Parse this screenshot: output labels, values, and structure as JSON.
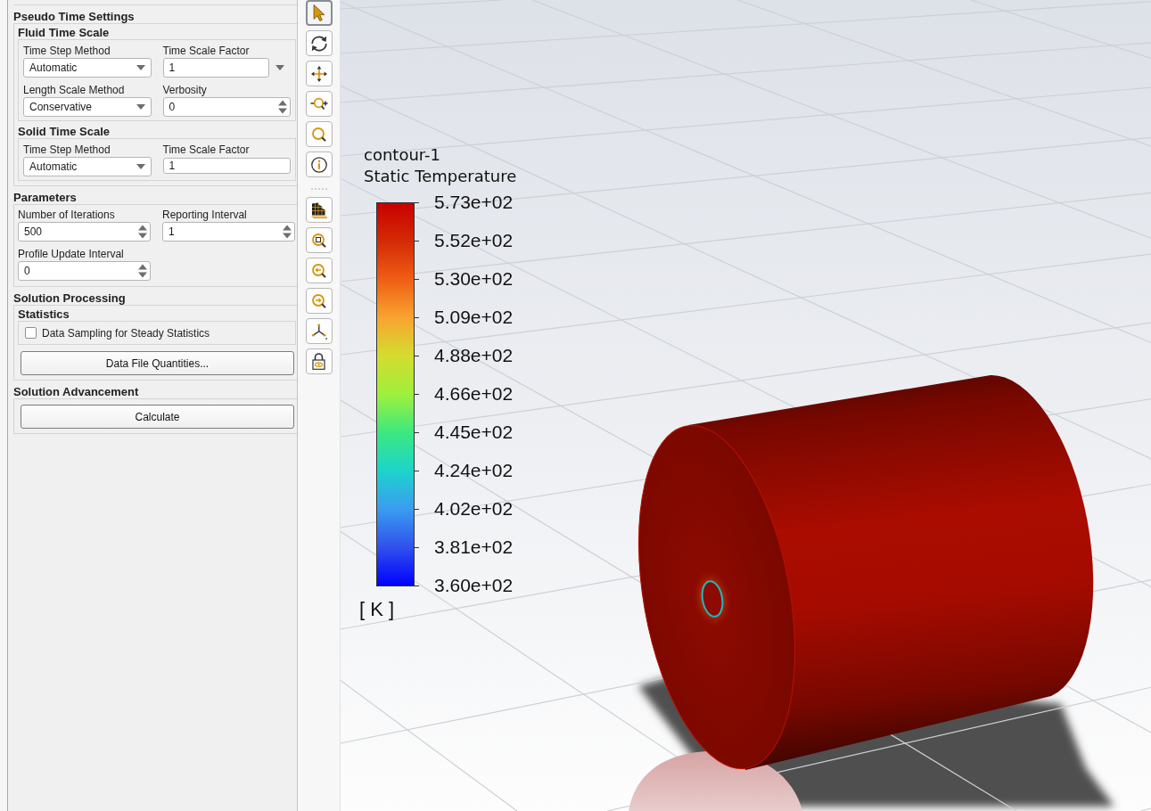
{
  "panel": {
    "sections": [
      {
        "title": "Pseudo Time Settings",
        "groups": [
          {
            "title": "Fluid Time Scale",
            "fields": [
              {
                "kind": "dropdown",
                "label": "Time Step Method",
                "value": "Automatic"
              },
              {
                "kind": "combo",
                "label": "Time Scale Factor",
                "value": "1"
              },
              {
                "kind": "dropdown",
                "label": "Length Scale Method",
                "value": "Conservative"
              },
              {
                "kind": "spinner",
                "label": "Verbosity",
                "value": "0"
              }
            ]
          },
          {
            "title": "Solid Time Scale",
            "fields": [
              {
                "kind": "dropdown",
                "label": "Time Step Method",
                "value": "Automatic"
              },
              {
                "kind": "text",
                "label": "Time Scale Factor",
                "value": "1"
              }
            ]
          }
        ]
      },
      {
        "title": "Parameters",
        "fields": [
          {
            "kind": "spinner",
            "label": "Number of Iterations",
            "value": "500"
          },
          {
            "kind": "spinner",
            "label": "Reporting Interval",
            "value": "1"
          },
          {
            "kind": "spinner",
            "label": "Profile Update Interval",
            "value": "0"
          }
        ]
      },
      {
        "title": "Solution Processing",
        "groups": [
          {
            "title": "Statistics",
            "checkboxes": [
              {
                "label": "Data Sampling for Steady Statistics",
                "checked": false
              }
            ]
          }
        ],
        "buttons": [
          "Data File Quantities..."
        ]
      },
      {
        "title": "Solution Advancement",
        "buttons": [
          "Calculate"
        ]
      }
    ]
  },
  "toolbar": {
    "groups": [
      {
        "tools": [
          {
            "kind": "pointer",
            "selected": true
          },
          {
            "kind": "rotate",
            "selected": false
          },
          {
            "kind": "move",
            "selected": false
          },
          {
            "kind": "dolly",
            "selected": false
          },
          {
            "kind": "magnifier",
            "selected": false
          },
          {
            "kind": "info",
            "selected": false
          }
        ]
      },
      {
        "tools": [
          {
            "kind": "shading",
            "selected": false
          },
          {
            "kind": "zoombox",
            "selected": false
          },
          {
            "kind": "magleft",
            "selected": false
          },
          {
            "kind": "magright",
            "selected": false
          },
          {
            "kind": "axes",
            "selected": false
          },
          {
            "kind": "lock",
            "selected": false
          }
        ]
      }
    ]
  },
  "viewport": {
    "legend": {
      "title": "contour-1",
      "quantity": "Static Temperature",
      "labels": [
        "5.73e+02",
        "5.52e+02",
        "5.30e+02",
        "5.09e+02",
        "4.88e+02",
        "4.66e+02",
        "4.45e+02",
        "4.24e+02",
        "4.02e+02",
        "3.81e+02",
        "3.60e+02"
      ],
      "unit": "[ K ]"
    }
  }
}
